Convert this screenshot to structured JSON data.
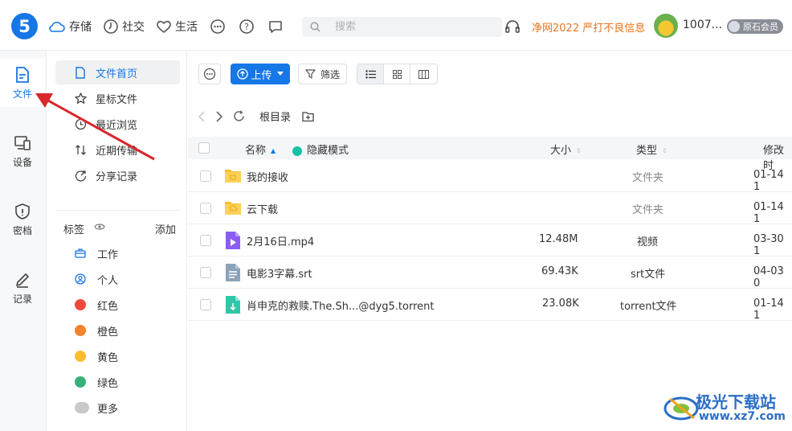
{
  "brand": {
    "logo_text": "5",
    "accent": "#1677e6"
  },
  "topnav": {
    "items": [
      {
        "label": "存储",
        "icon": "cloud-icon"
      },
      {
        "label": "社交",
        "icon": "clock-icon"
      },
      {
        "label": "生活",
        "icon": "heart-icon"
      }
    ],
    "search_placeholder": "搜索",
    "promo": "净网2022 严打不良信息",
    "user_id": "1007...",
    "member_badge": "原石会员"
  },
  "rail": {
    "items": [
      {
        "label": "文件",
        "icon": "file-icon",
        "active": true
      },
      {
        "label": "设备",
        "icon": "device-icon"
      },
      {
        "label": "密档",
        "icon": "shield-icon"
      },
      {
        "label": "记录",
        "icon": "pen-icon"
      }
    ]
  },
  "sidebar": {
    "items": [
      {
        "label": "文件首页",
        "icon": "document-icon",
        "active": true
      },
      {
        "label": "星标文件",
        "icon": "star-icon"
      },
      {
        "label": "最近浏览",
        "icon": "history-icon"
      },
      {
        "label": "近期传输",
        "icon": "transfer-icon"
      },
      {
        "label": "分享记录",
        "icon": "share-icon"
      }
    ],
    "tags_title": "标签",
    "tags_add": "添加",
    "tags": [
      {
        "label": "工作",
        "type": "icon",
        "icon": "briefcase-icon"
      },
      {
        "label": "个人",
        "type": "icon",
        "icon": "person-icon"
      },
      {
        "label": "红色",
        "color": "#f04a3c"
      },
      {
        "label": "橙色",
        "color": "#f5822c"
      },
      {
        "label": "黄色",
        "color": "#fbbd2c"
      },
      {
        "label": "绿色",
        "color": "#34b27a"
      },
      {
        "label": "更多",
        "color": "#c8c9cc"
      }
    ]
  },
  "toolbar": {
    "upload_label": "上传",
    "filter_label": "筛选",
    "view_mode": "list"
  },
  "breadcrumb": {
    "root": "根目录"
  },
  "table": {
    "headers": {
      "name": "名称",
      "privacy": "隐藏模式",
      "size": "大小",
      "type": "类型",
      "modified": "修改时"
    },
    "rows": [
      {
        "name": "我的接收",
        "size": "",
        "type": "文件夹",
        "modified": "01-14 1",
        "icon": "folder-icon"
      },
      {
        "name": "云下载",
        "size": "",
        "type": "文件夹",
        "modified": "01-14 1",
        "icon": "folder-icon"
      },
      {
        "name": "2月16日.mp4",
        "size": "12.48M",
        "type": "视频",
        "modified": "03-30 1",
        "icon": "video-file-icon"
      },
      {
        "name": "电影3字幕.srt",
        "size": "69.43K",
        "type": "srt文件",
        "modified": "04-03 0",
        "icon": "text-file-icon"
      },
      {
        "name": "肖申克的救赎.The.Sh...@dyg5.torrent",
        "size": "23.08K",
        "type": "torrent文件",
        "modified": "01-14 1",
        "icon": "torrent-file-icon"
      }
    ]
  },
  "watermark": {
    "title": "极光下载站",
    "url": "www.xz7.com"
  }
}
